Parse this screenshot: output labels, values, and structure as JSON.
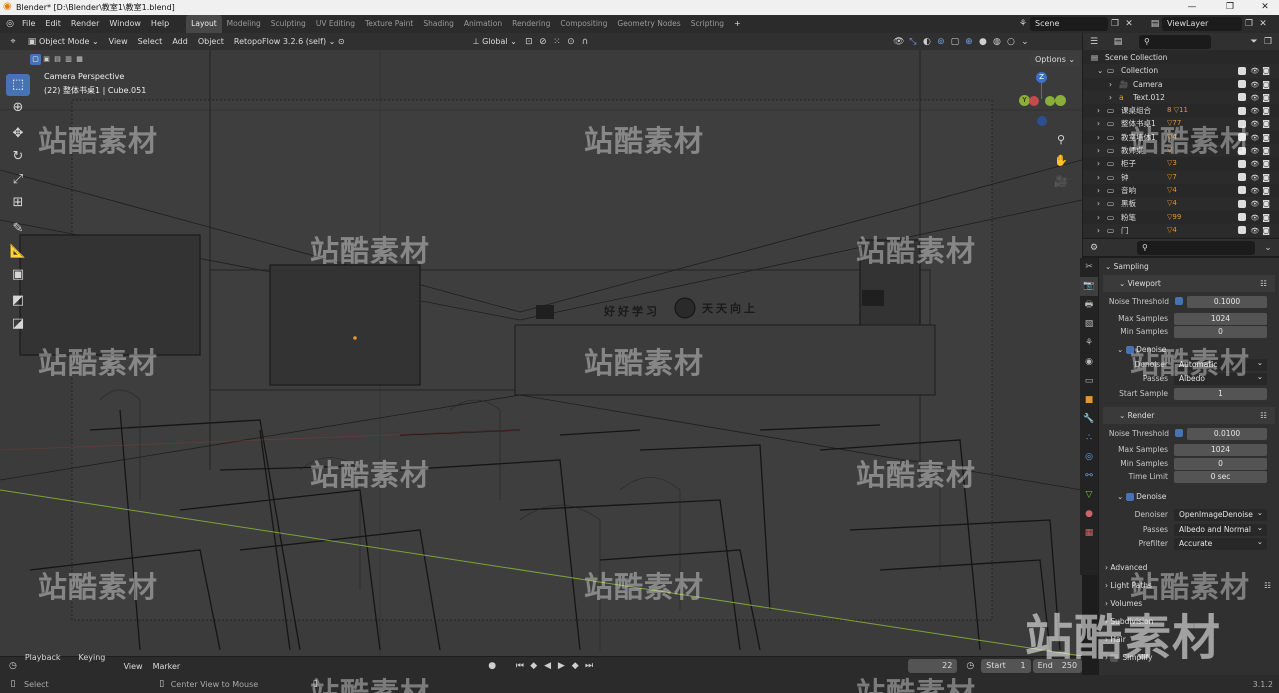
{
  "window": {
    "title": "Blender* [D:\\Blender\\教室1\\教室1.blend]",
    "minimize": "—",
    "maximize": "❐",
    "close": "✕"
  },
  "menubar": {
    "menus": [
      "File",
      "Edit",
      "Render",
      "Window",
      "Help"
    ],
    "workspaces": [
      "Layout",
      "Modeling",
      "Sculpting",
      "UV Editing",
      "Texture Paint",
      "Shading",
      "Animation",
      "Rendering",
      "Compositing",
      "Geometry Nodes",
      "Scripting"
    ],
    "active_workspace": "Layout",
    "add_workspace": "+",
    "scene": "Scene",
    "view_layer": "ViewLayer"
  },
  "viewport_header": {
    "mode": "Object Mode",
    "menus": [
      "View",
      "Select",
      "Add",
      "Object"
    ],
    "addon": "RetopoFlow 3.2.6 (self)",
    "transform": "Global",
    "options": "Options"
  },
  "viewport": {
    "camera": "Camera Perspective",
    "info": "(22) 整体书桌1 | Cube.051",
    "gizmo": {
      "z": "Z",
      "y": "Y",
      "x": "X"
    },
    "board_text_left": "好好学习",
    "board_text_right": "天天向上"
  },
  "toolbar": {
    "tools": [
      "select-box-tool",
      "cursor-tool",
      "move-tool",
      "rotate-tool",
      "scale-tool",
      "transform-tool",
      "annotate-tool",
      "measure-tool",
      "add-cube-tool",
      "extra-tool-1",
      "extra-tool-2"
    ]
  },
  "outliner": {
    "scene_collection": "Scene Collection",
    "items": [
      {
        "label": "Collection",
        "indent": 1
      },
      {
        "label": "Camera",
        "indent": 2
      },
      {
        "label": "Text.012",
        "indent": 2
      },
      {
        "label": "课桌组合",
        "indent": 1,
        "badge": "8 ▽11"
      },
      {
        "label": "整体书桌1",
        "indent": 1,
        "badge": "▽77"
      },
      {
        "label": "教室墙体1",
        "indent": 1,
        "badge": "▽4"
      },
      {
        "label": "教师桌",
        "indent": 1,
        "badge": "▽"
      },
      {
        "label": "柜子",
        "indent": 1,
        "badge": "▽3"
      },
      {
        "label": "钟",
        "indent": 1,
        "badge": "▽7"
      },
      {
        "label": "音响",
        "indent": 1,
        "badge": "▽4"
      },
      {
        "label": "黑板",
        "indent": 1,
        "badge": "▽4"
      },
      {
        "label": "粉笔",
        "indent": 1,
        "badge": "▽99"
      },
      {
        "label": "门",
        "indent": 1,
        "badge": "▽4"
      }
    ]
  },
  "properties": {
    "sampling": "Sampling",
    "viewport_section": "Viewport",
    "viewport": {
      "noise_threshold_label": "Noise Threshold",
      "noise_threshold": "0.1000",
      "max_samples_label": "Max Samples",
      "max_samples": "1024",
      "min_samples_label": "Min Samples",
      "min_samples": "0",
      "denoise": "Denoise",
      "denoiser_label": "Denoiser",
      "denoiser": "Automatic",
      "passes_label": "Passes",
      "passes": "Albedo",
      "start_sample_label": "Start Sample",
      "start_sample": "1"
    },
    "render_section": "Render",
    "render": {
      "noise_threshold_label": "Noise Threshold",
      "noise_threshold": "0.0100",
      "max_samples_label": "Max Samples",
      "max_samples": "1024",
      "min_samples_label": "Min Samples",
      "min_samples": "0",
      "time_limit_label": "Time Limit",
      "time_limit": "0 sec",
      "denoise": "Denoise",
      "denoiser_label": "Denoiser",
      "denoiser": "OpenImageDenoise",
      "passes_label": "Passes",
      "passes": "Albedo and Normal",
      "prefilter_label": "Prefilter",
      "prefilter": "Accurate"
    },
    "collapsed": [
      "Advanced",
      "Light Paths",
      "Volumes",
      "Subdivision",
      "Hair",
      "Simplify"
    ]
  },
  "timeline": {
    "menus": [
      "Playback",
      "Keying",
      "View",
      "Marker"
    ],
    "current_frame": "22",
    "start_label": "Start",
    "start": "1",
    "end_label": "End",
    "end": "250"
  },
  "statusbar": {
    "left": "Select",
    "middle": "Center View to Mouse",
    "version": "3.1.2"
  },
  "watermark": "站酷素材",
  "colors": {
    "accent": "#4772b3",
    "header": "#303030",
    "viewport": "#3a3a3a",
    "panel": "#282828"
  }
}
